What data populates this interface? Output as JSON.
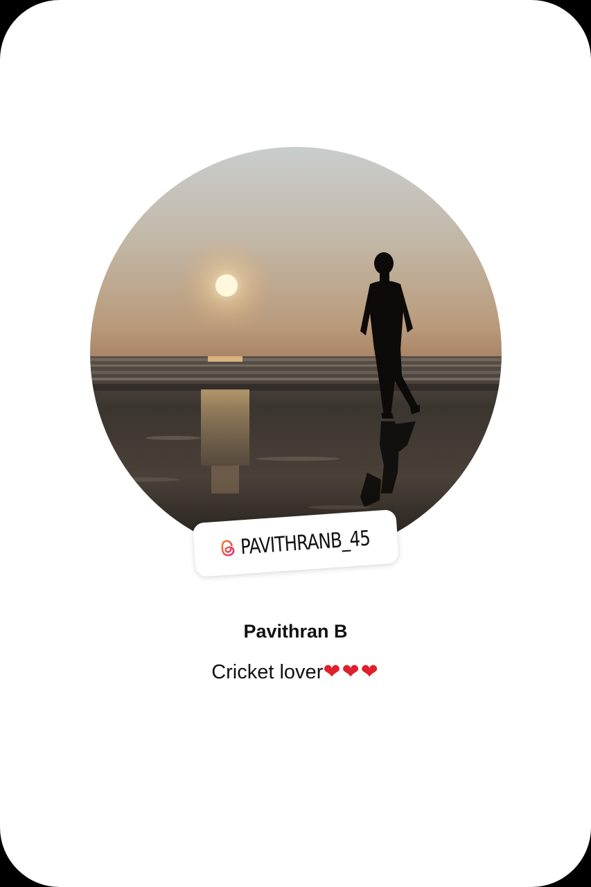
{
  "profile": {
    "handle": "PAVITHRANB_45",
    "name": "Pavithran B",
    "bio_text": "Cricket lover",
    "bio_emoji": "❤❤❤"
  },
  "icons": {
    "handle_icon": "threads-icon"
  },
  "colors": {
    "card_background": "#ffffff",
    "frame_background": "#000000",
    "text": "#111111",
    "threads_gradient_start": "#f58529",
    "threads_gradient_end": "#dd2a7b",
    "heart": "#e0202c"
  }
}
